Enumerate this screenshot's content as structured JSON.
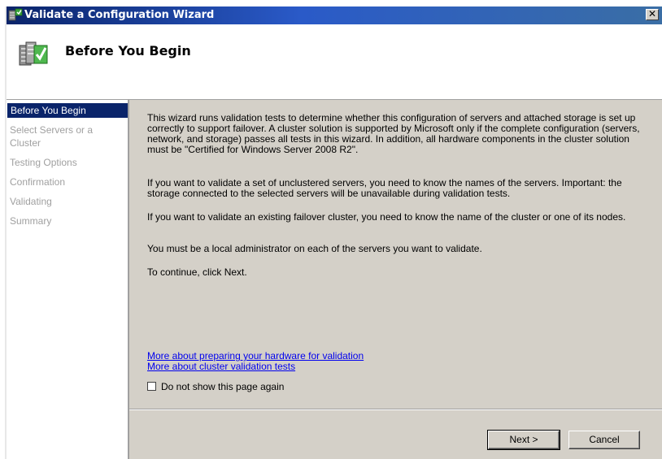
{
  "window": {
    "title": "Validate a Configuration Wizard",
    "close_glyph": "✕"
  },
  "header": {
    "title": "Before You Begin"
  },
  "nav": {
    "items": [
      {
        "label": "Before You Begin",
        "active": true
      },
      {
        "label": "Select Servers or a Cluster",
        "active": false
      },
      {
        "label": "Testing Options",
        "active": false
      },
      {
        "label": "Confirmation",
        "active": false
      },
      {
        "label": "Validating",
        "active": false
      },
      {
        "label": "Summary",
        "active": false
      }
    ]
  },
  "content": {
    "paragraphs": [
      "This wizard runs validation tests to determine whether this configuration of servers and attached storage is set up correctly to support failover. A cluster solution is supported by Microsoft only if the complete configuration (servers, network, and storage) passes all tests in this wizard. In addition, all hardware components in the cluster solution must be \"Certified for Windows Server 2008 R2\".",
      "If you want to validate a set of unclustered servers, you need to know the names of the servers. Important: the storage connected to the selected servers will be unavailable during validation tests.",
      "If you want to validate an existing failover cluster, you need to know the name of the cluster or one of its nodes.",
      "You must be a local administrator on each of the servers you want to validate.",
      "To continue, click Next."
    ],
    "links": [
      "More about preparing your hardware for validation",
      "More about cluster validation tests"
    ],
    "checkbox_label": "Do not show this page again",
    "checkbox_checked": false
  },
  "footer": {
    "next_label": "Next >",
    "cancel_label": "Cancel"
  },
  "colors": {
    "titlebar": "#0a246a",
    "nav_active": "#0a246a",
    "nav_inactive_text": "#a0a0a0",
    "dialog_face": "#d4d0c8",
    "link": "#0000ee"
  },
  "icons": {
    "app": "cluster-wizard-icon",
    "header": "servers-checkmark-icon"
  }
}
